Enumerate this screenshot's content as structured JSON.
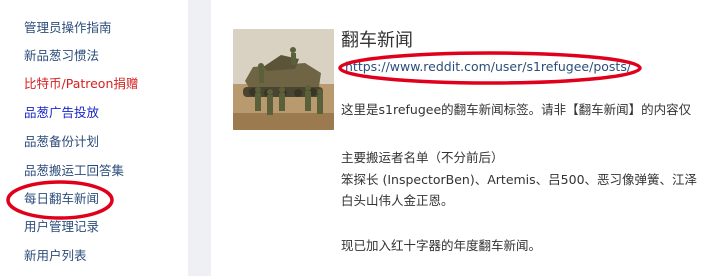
{
  "sidebar": {
    "items": [
      {
        "label": "管理员操作指南"
      },
      {
        "label": "新品葱习惯法"
      },
      {
        "label": "比特币/Patreon捐赠"
      },
      {
        "label": "品葱广告投放"
      },
      {
        "label": "品葱备份计划"
      },
      {
        "label": "品葱搬运工回答集"
      },
      {
        "label": "每日翻车新闻"
      },
      {
        "label": "用户管理记录"
      },
      {
        "label": "新用户列表"
      }
    ]
  },
  "topic": {
    "title": "翻车新闻",
    "url": "https://www.reddit.com/user/s1refugee/posts/",
    "description": [
      "这里是s1refugee的翻车新闻标签。请非【翻车新闻】的内容仅",
      "主要搬运者名单（不分前后）",
      "笨探长 (InspectorBen)、Artemis、吕500、恶习像弹簧、江泽",
      "白头山伟人金正恩。",
      "现已加入红十字器的年度翻车新闻。"
    ]
  },
  "colors": {
    "link": "#2b4d7a",
    "highlight_red": "#d42020",
    "highlight_blue": "#1826c8",
    "annotation": "#e0001b"
  }
}
